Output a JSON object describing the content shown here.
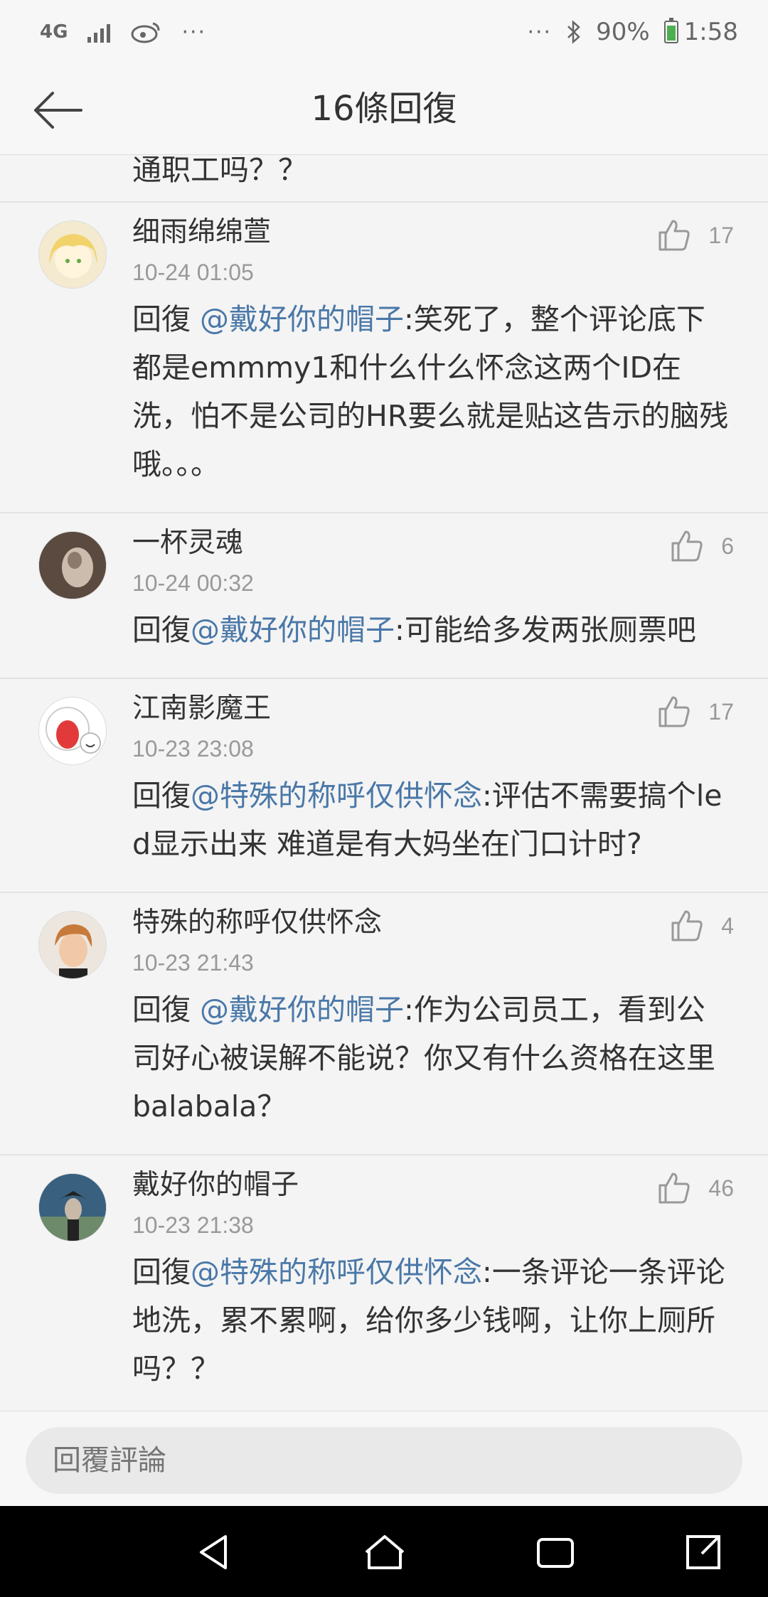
{
  "status_bar": {
    "network": "4G",
    "more": "···",
    "more_right": "···",
    "battery": "90%",
    "time": "1:58"
  },
  "header": {
    "title": "16條回復",
    "back_icon": "arrow-left-icon"
  },
  "partial_comment": {
    "text": "通职工吗？？"
  },
  "comments": [
    {
      "user": "细雨绵绵萱",
      "time": "10-24 01:05",
      "likes": "17",
      "reply_prefix": "回復 ",
      "mention": "@戴好你的帽子",
      "text": ":笑死了，整个评论底下都是emmmy1和什么什么怀念这两个ID在洗，怕不是公司的HR要么就是贴这告示的脑残哦。。。"
    },
    {
      "user": "一杯灵魂",
      "time": "10-24 00:32",
      "likes": "6",
      "reply_prefix": "回復",
      "mention": "@戴好你的帽子",
      "text": ":可能给多发两张厕票吧"
    },
    {
      "user": "江南影魔王",
      "time": "10-23 23:08",
      "likes": "17",
      "reply_prefix": "回復",
      "mention": "@特殊的称呼仅供怀念",
      "text": ":评估不需要搞个led显示出来 难道是有大妈坐在门口计时?"
    },
    {
      "user": "特殊的称呼仅供怀念",
      "time": "10-23 21:43",
      "likes": "4",
      "reply_prefix": "回復 ",
      "mention": "@戴好你的帽子",
      "text": ":作为公司员工，看到公司好心被误解不能说？你又有什么资格在这里balabala？"
    },
    {
      "user": "戴好你的帽子",
      "time": "10-23 21:38",
      "likes": "46",
      "reply_prefix": "回復",
      "mention": "@特殊的称呼仅供怀念",
      "text": ":一条评论一条评论地洗，累不累啊，给你多少钱啊，让你上厕所吗？？"
    }
  ],
  "reply_bar": {
    "placeholder": "回覆評論"
  },
  "colors": {
    "mention": "#4a78a8",
    "background": "#f4f4f4",
    "battery_fill": "#4caf50"
  }
}
